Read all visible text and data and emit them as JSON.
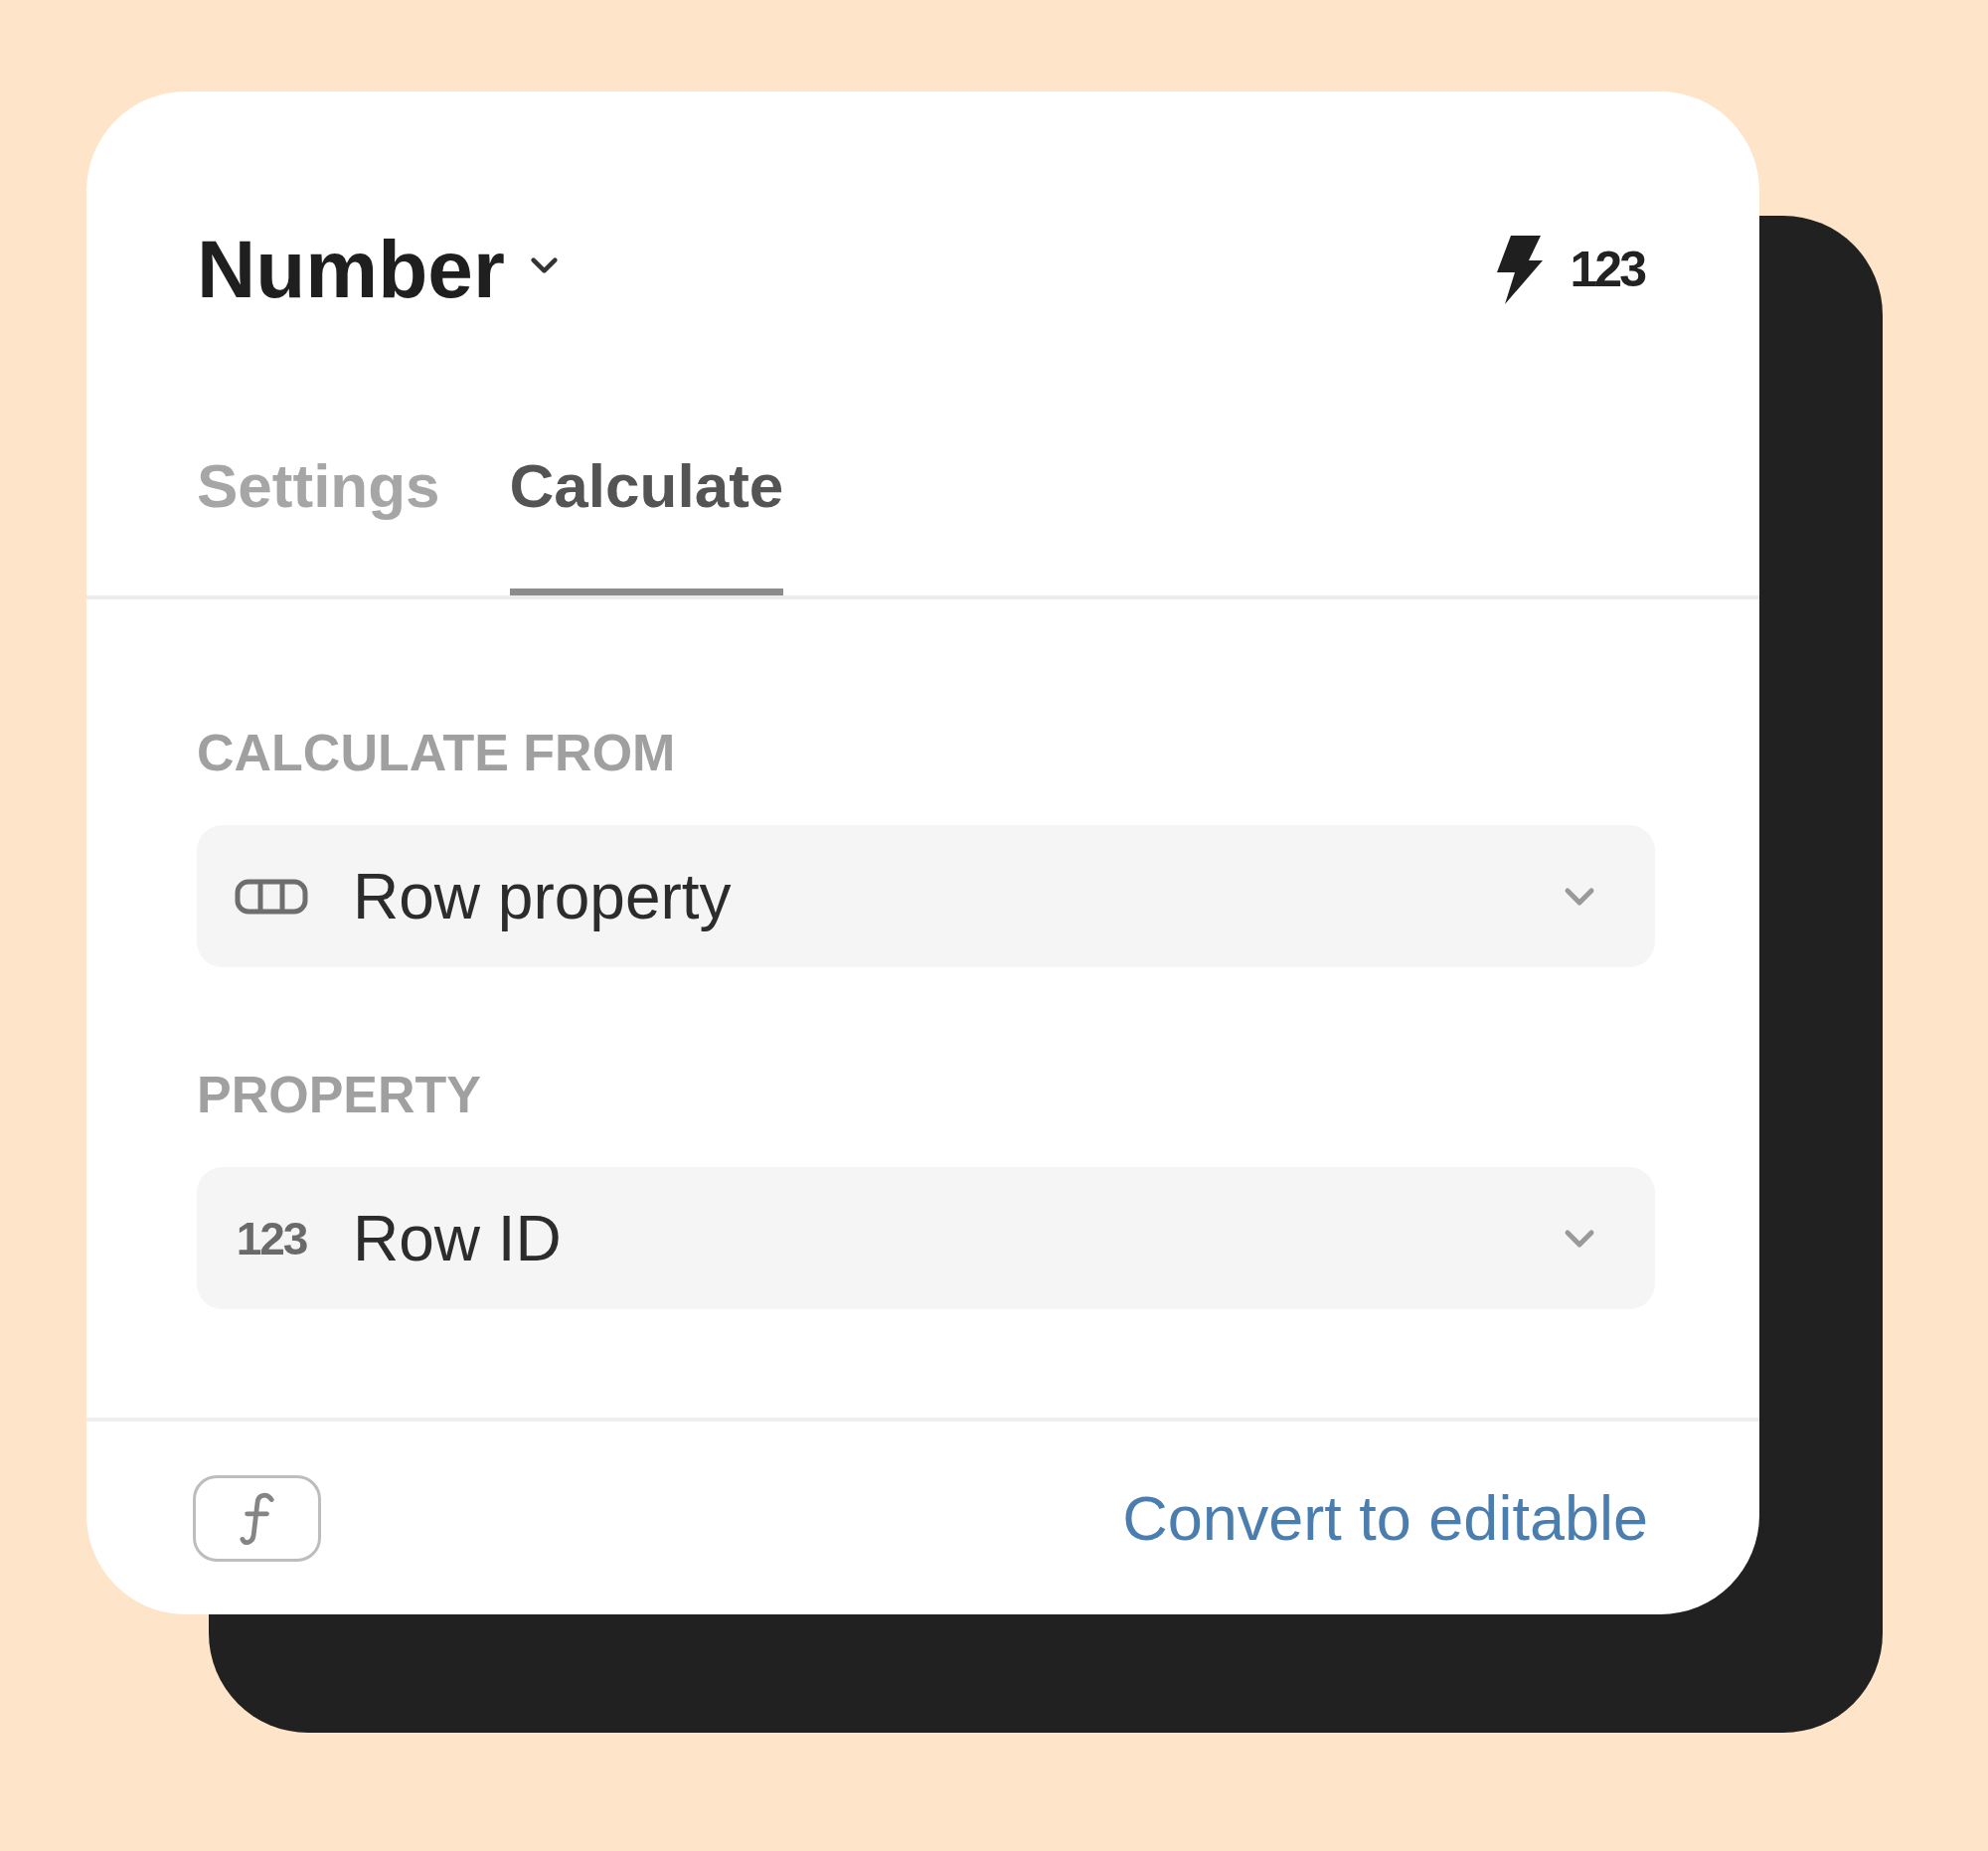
{
  "panel": {
    "title": "Number",
    "type_badge": "123"
  },
  "tabs": [
    {
      "label": "Settings",
      "selected": false
    },
    {
      "label": "Calculate",
      "selected": true
    }
  ],
  "fields": [
    {
      "label": "CALCULATE FROM",
      "kind": "ribbon",
      "value": "Row property"
    },
    {
      "label": "PROPERTY",
      "kind": "number",
      "icon_text": "123",
      "value": "Row ID"
    }
  ],
  "footer": {
    "link": "Convert to editable"
  }
}
